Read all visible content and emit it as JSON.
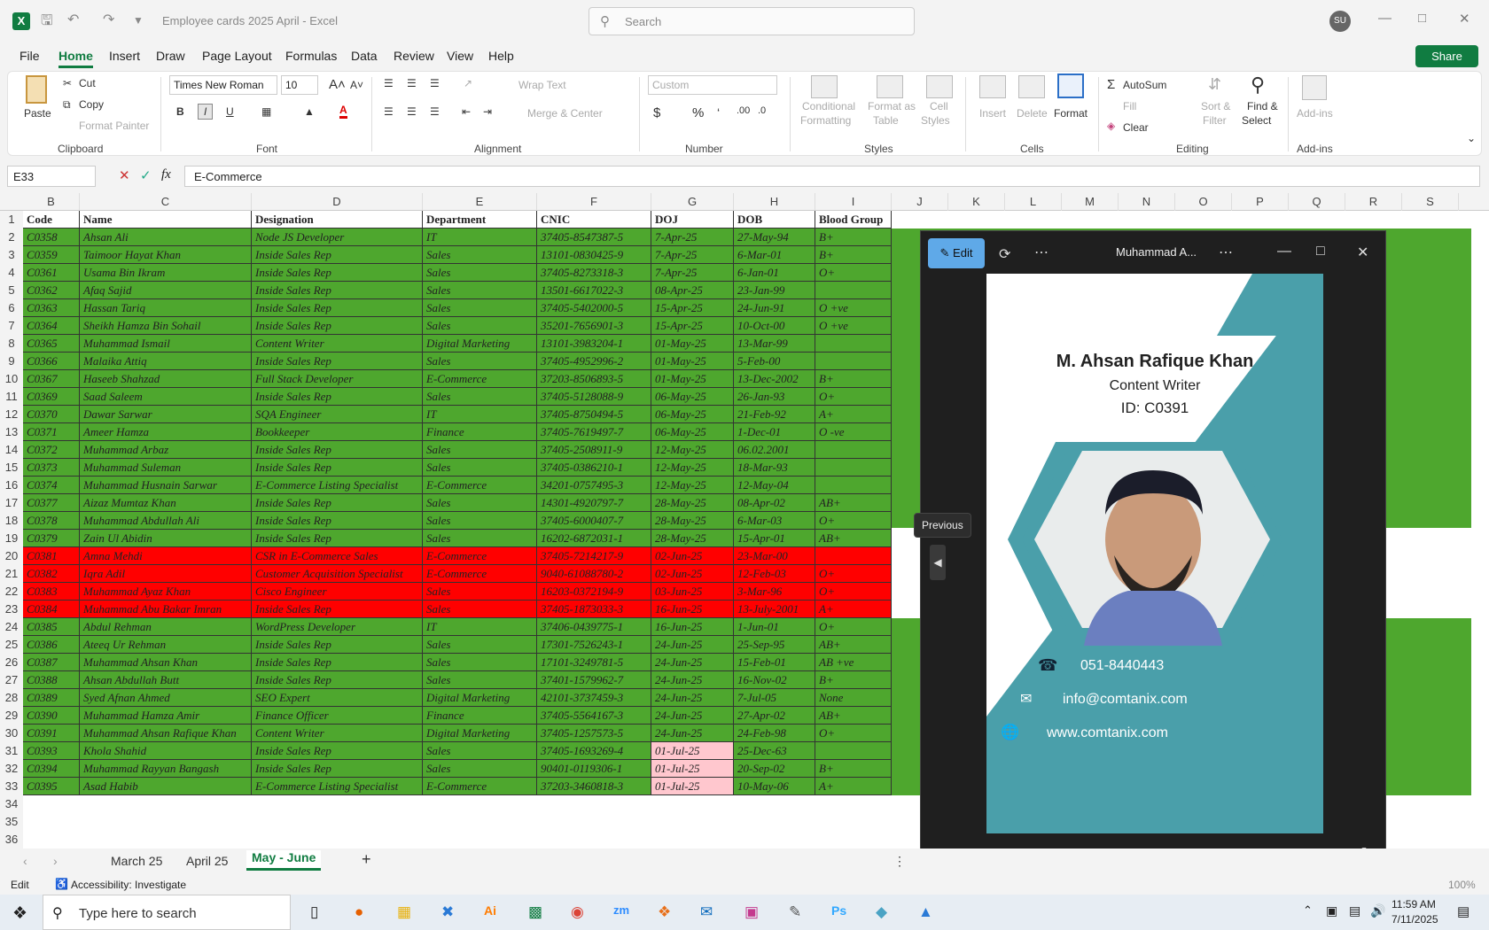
{
  "app": {
    "title": "Employee cards 2025 April  -  Excel",
    "search_placeholder": "Search",
    "user_initials": "SU",
    "menu": [
      "File",
      "Home",
      "Insert",
      "Draw",
      "Page Layout",
      "Formulas",
      "Data",
      "Review",
      "View",
      "Help"
    ],
    "share_label": "Share"
  },
  "ribbon": {
    "clipboard": {
      "paste": "Paste",
      "cut": "Cut",
      "copy": "Copy",
      "format_painter": "Format Painter",
      "group": "Clipboard"
    },
    "font": {
      "name": "Times New Roman",
      "size": "10",
      "bold": "B",
      "italic": "I",
      "underline": "U",
      "group": "Font"
    },
    "alignment": {
      "wrap": "Wrap Text",
      "merge": "Merge & Center",
      "group": "Alignment"
    },
    "number": {
      "format": "Custom",
      "group": "Number"
    },
    "styles": {
      "cond1": "Conditional",
      "cond2": "Formatting",
      "fmt1": "Format as",
      "fmt2": "Table",
      "cell1": "Cell",
      "cell2": "Styles",
      "group": "Styles"
    },
    "cells": {
      "insert": "Insert",
      "delete": "Delete",
      "format": "Format",
      "group": "Cells"
    },
    "editing": {
      "autosum": "AutoSum",
      "fill": "Fill",
      "clear": "Clear",
      "sort1": "Sort &",
      "sort2": "Filter",
      "find1": "Find &",
      "find2": "Select",
      "group": "Editing"
    },
    "addins": {
      "label": "Add-ins",
      "group": "Add-ins"
    }
  },
  "formula_bar": {
    "name_box": "E33",
    "formula": "E-Commerce"
  },
  "columns": [
    "B",
    "C",
    "D",
    "E",
    "F",
    "G",
    "H",
    "I",
    "J",
    "K",
    "L",
    "M",
    "N",
    "O",
    "P",
    "Q",
    "R",
    "S"
  ],
  "headers": [
    "Code",
    "Name",
    "Designation",
    "Department",
    "CNIC",
    "DOJ",
    "DOB",
    "Blood Group"
  ],
  "rows": [
    [
      "C0358",
      "Ahsan Ali",
      "Node JS Developer",
      "IT",
      "37405-8547387-5",
      "7-Apr-25",
      "27-May-94",
      "B+"
    ],
    [
      "C0359",
      "Taimoor Hayat Khan",
      "Inside Sales Rep",
      "Sales",
      "13101-0830425-9",
      "7-Apr-25",
      "6-Mar-01",
      "B+"
    ],
    [
      "C0361",
      "Usama Bin Ikram",
      "Inside Sales Rep",
      "Sales",
      "37405-8273318-3",
      "7-Apr-25",
      "6-Jan-01",
      "O+"
    ],
    [
      "C0362",
      "Afaq Sajid",
      "Inside Sales Rep",
      "Sales",
      "13501-6617022-3",
      "08-Apr-25",
      "23-Jan-99",
      ""
    ],
    [
      "C0363",
      "Hassan Tariq",
      "Inside Sales Rep",
      "Sales",
      "37405-5402000-5",
      "15-Apr-25",
      "24-Jun-91",
      "O +ve"
    ],
    [
      "C0364",
      "Sheikh Hamza Bin Sohail",
      "Inside Sales Rep",
      "Sales",
      "35201-7656901-3",
      "15-Apr-25",
      "10-Oct-00",
      "O +ve"
    ],
    [
      "C0365",
      "Muhammad Ismail",
      "Content Writer",
      "Digital Marketing",
      "13101-3983204-1",
      "01-May-25",
      "13-Mar-99",
      ""
    ],
    [
      "C0366",
      "Malaika Attiq",
      "Inside Sales Rep",
      "Sales",
      "37405-4952996-2",
      "01-May-25",
      "5-Feb-00",
      ""
    ],
    [
      "C0367",
      "Haseeb Shahzad",
      "Full Stack Developer",
      "E-Commerce",
      "37203-8506893-5",
      "01-May-25",
      "13-Dec-2002",
      "B+"
    ],
    [
      "C0369",
      "Saad Saleem",
      "Inside Sales Rep",
      "Sales",
      "37405-5128088-9",
      "06-May-25",
      "26-Jan-93",
      "O+"
    ],
    [
      "C0370",
      "Dawar Sarwar",
      "SQA Engineer",
      "IT",
      "37405-8750494-5",
      "06-May-25",
      "21-Feb-92",
      "A+"
    ],
    [
      "C0371",
      "Ameer Hamza",
      "Bookkeeper",
      "Finance",
      "37405-7619497-7",
      "06-May-25",
      "1-Dec-01",
      "O -ve"
    ],
    [
      "C0372",
      "Muhammad Arbaz",
      "Inside Sales Rep",
      "Sales",
      "37405-2508911-9",
      "12-May-25",
      "06.02.2001",
      ""
    ],
    [
      "C0373",
      "Muhammad Suleman",
      "Inside Sales Rep",
      "Sales",
      "37405-0386210-1",
      "12-May-25",
      "18-Mar-93",
      ""
    ],
    [
      "C0374",
      "Muhammad Husnain Sarwar",
      "E-Commerce Listing Specialist",
      "E-Commerce",
      "34201-0757495-3",
      "12-May-25",
      "12-May-04",
      ""
    ],
    [
      "C0377",
      "Aizaz Mumtaz Khan",
      "Inside Sales Rep",
      "Sales",
      "14301-4920797-7",
      "28-May-25",
      "08-Apr-02",
      "AB+"
    ],
    [
      "C0378",
      "Muhammad Abdullah Ali",
      "Inside Sales Rep",
      "Sales",
      "37405-6000407-7",
      "28-May-25",
      "6-Mar-03",
      "O+"
    ],
    [
      "C0379",
      "Zain Ul Abidin",
      "Inside Sales Rep",
      "Sales",
      "16202-6872031-1",
      "28-May-25",
      "15-Apr-01",
      "AB+"
    ],
    [
      "C0381",
      "Amna Mehdi",
      "CSR in E-Commerce Sales",
      "E-Commerce",
      "37405-7214217-9",
      "02-Jun-25",
      "23-Mar-00",
      ""
    ],
    [
      "C0382",
      "Iqra Adil",
      "Customer Acquisition Specialist",
      "E-Commerce",
      "9040-61088780-2",
      "02-Jun-25",
      "12-Feb-03",
      "O+"
    ],
    [
      "C0383",
      "Muhammad Ayaz Khan",
      "Cisco Engineer",
      "Sales",
      "16203-0372194-9",
      "03-Jun-25",
      "3-Mar-96",
      "O+"
    ],
    [
      "C0384",
      "Muhammad Abu Bakar Imran",
      "Inside Sales Rep",
      "Sales",
      "37405-1873033-3",
      "16-Jun-25",
      "13-July-2001",
      "A+"
    ],
    [
      "C0385",
      "Abdul Rehman",
      "WordPress Developer",
      "IT",
      "37406-0439775-1",
      "16-Jun-25",
      "1-Jun-01",
      "O+"
    ],
    [
      "C0386",
      "Ateeq Ur Rehman",
      "Inside Sales Rep",
      "Sales",
      "17301-7526243-1",
      "24-Jun-25",
      "25-Sep-95",
      "AB+"
    ],
    [
      "C0387",
      "Muhammad Ahsan Khan",
      "Inside Sales Rep",
      "Sales",
      "17101-3249781-5",
      "24-Jun-25",
      "15-Feb-01",
      "AB +ve"
    ],
    [
      "C0388",
      "Ahsan Abdullah Butt",
      "Inside Sales Rep",
      "Sales",
      "37401-1579962-7",
      "24-Jun-25",
      "16-Nov-02",
      "B+"
    ],
    [
      "C0389",
      "Syed Afnan Ahmed",
      "SEO Expert",
      "Digital Marketing",
      "42101-3737459-3",
      "24-Jun-25",
      "7-Jul-05",
      "None"
    ],
    [
      "C0390",
      "Muhammad Hamza Amir",
      "Finance Officer",
      "Finance",
      "37405-5564167-3",
      "24-Jun-25",
      "27-Apr-02",
      "AB+"
    ],
    [
      "C0391",
      "Muhammad Ahsan Rafique Khan",
      "Content Writer",
      "Digital Marketing",
      "37405-1257573-5",
      "24-Jun-25",
      "24-Feb-98",
      "O+"
    ],
    [
      "C0393",
      "Khola Shahid",
      "Inside Sales Rep",
      "Sales",
      "37405-1693269-4",
      "01-Jul-25",
      "25-Dec-63",
      ""
    ],
    [
      "C0394",
      "Muhammad Rayyan Bangash",
      "Inside Sales Rep",
      "Sales",
      "90401-0119306-1",
      "01-Jul-25",
      "20-Sep-02",
      "B+"
    ],
    [
      "C0395",
      "Asad Habib",
      "E-Commerce Listing Specialist",
      "E-Commerce",
      "37203-3460818-3",
      "01-Jul-25",
      "10-May-06",
      "A+"
    ]
  ],
  "row_numbers": [
    "1",
    "2",
    "3",
    "4",
    "5",
    "6",
    "7",
    "8",
    "9",
    "10",
    "11",
    "12",
    "13",
    "14",
    "15",
    "16",
    "17",
    "18",
    "19",
    "20",
    "21",
    "22",
    "23",
    "24",
    "25",
    "26",
    "27",
    "28",
    "29",
    "30",
    "31",
    "32",
    "33",
    "34",
    "35",
    "36"
  ],
  "colors": {
    "green": "#4ea72e",
    "red": "#ff0000",
    "pink": "#ffc7ce",
    "teal": "#4a9faa",
    "excel": "#107c41"
  },
  "sheet_tabs": [
    "March 25",
    "April 25",
    "May - June"
  ],
  "status": {
    "mode": "Edit",
    "accessibility": "Accessibility: Investigate",
    "zoom": "100%"
  },
  "photo_viewer": {
    "edit_label": "Edit",
    "title": "Muhammad A...",
    "prev_tooltip": "Previous",
    "card": {
      "name": "M. Ahsan Rafique Khan",
      "role": "Content Writer",
      "id": "ID: C0391",
      "phone": "051-8440443",
      "email": "info@comtanix.com",
      "web": "www.comtanix.com"
    }
  },
  "taskbar": {
    "search_placeholder": "Type here to search",
    "time": "11:59 AM",
    "date": "7/11/2025"
  }
}
